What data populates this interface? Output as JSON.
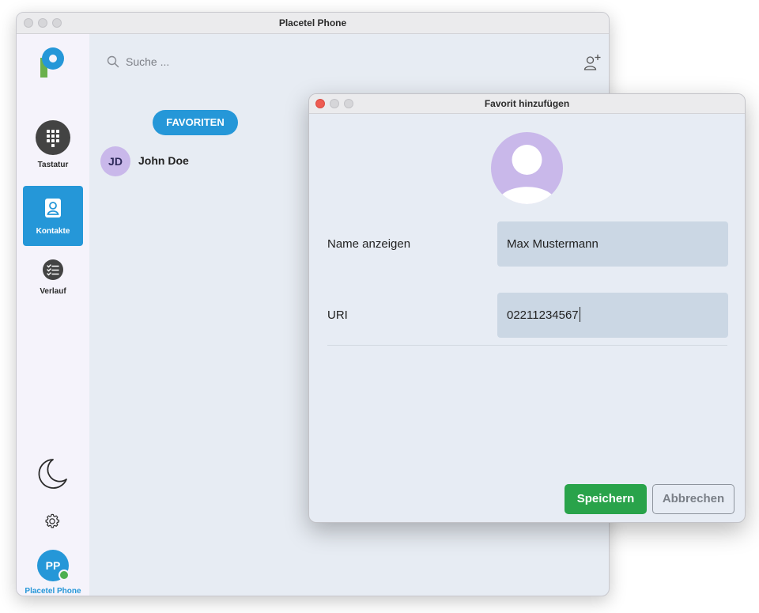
{
  "main_window": {
    "title": "Placetel Phone"
  },
  "sidebar": {
    "items": [
      {
        "label": "Tastatur",
        "icon": "keypad-icon",
        "active": false
      },
      {
        "label": "Kontakte",
        "icon": "contacts-icon",
        "active": true
      },
      {
        "label": "Verlauf",
        "icon": "history-icon",
        "active": false
      }
    ],
    "theme_icon": "moon-icon",
    "settings_icon": "gear-icon",
    "profile": {
      "initials": "PP",
      "label": "Placetel Phone",
      "status": "online"
    }
  },
  "contacts": {
    "search_placeholder": "Suche ...",
    "add_contact_icon": "add-contact-icon",
    "filter_label": "FAVORITEN",
    "list": [
      {
        "initials": "JD",
        "name": "John Doe"
      }
    ]
  },
  "dialog": {
    "title": "Favorit hinzufügen",
    "fields": {
      "name": {
        "label": "Name anzeigen",
        "value": "Max Mustermann"
      },
      "uri": {
        "label": "URI",
        "value": "02211234567"
      }
    },
    "save_label": "Speichern",
    "cancel_label": "Abbrechen"
  },
  "colors": {
    "accent_blue": "#2597d8",
    "save_green": "#29a34a",
    "avatar_lavender": "#c9b8ea",
    "online_green": "#4caf50",
    "close_red": "#ee5c52"
  }
}
